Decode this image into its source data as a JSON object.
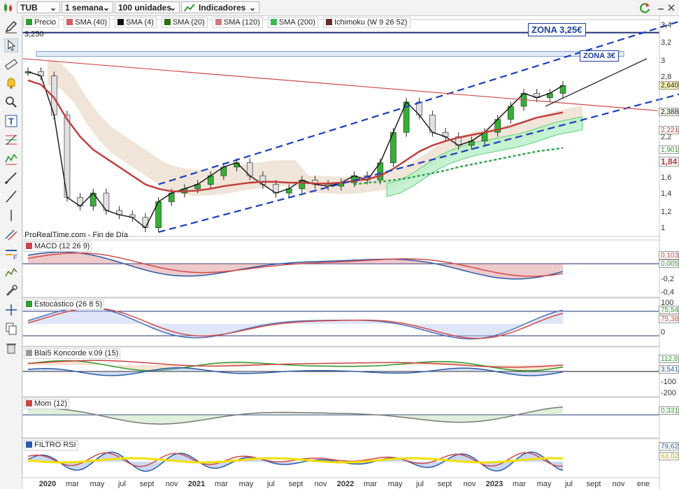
{
  "toolbar": {
    "ticker": "TUB",
    "period": "1 semana",
    "units": "100 unidades",
    "indicators": "Indicadores"
  },
  "price_legend": {
    "items": [
      {
        "label": "Precio",
        "color": "#2e9b2e"
      },
      {
        "label": "SMA (40)",
        "color": "#d95f5f"
      },
      {
        "label": "SMA (4)",
        "color": "#111111"
      },
      {
        "label": "SMA (20)",
        "color": "#2f6f12"
      },
      {
        "label": "SMA (120)",
        "color": "#cf7b7b"
      },
      {
        "label": "SMA (200)",
        "color": "#3dbb55"
      },
      {
        "label": "Ichimoku (W 9 26 52)",
        "color": "#6b2a2a"
      }
    ],
    "level_label": "3,250",
    "watermark": "ProRealTime.com - Fin de Día"
  },
  "annotations": {
    "zona_325": "ZONA 3,25€",
    "zona_3": "ZONA 3€"
  },
  "price_axis": {
    "ticks": [
      "3,4",
      "3,2",
      "3",
      "2,8",
      "2,6",
      "2,4",
      "2,2",
      "2",
      "1,8",
      "1,6",
      "1,4",
      "1,2",
      "1"
    ],
    "badges": [
      {
        "text": "2,640",
        "bg": "#f6f0b0"
      },
      {
        "text": "2,388",
        "bg": "#eef7e8"
      },
      {
        "text": "2,221",
        "bg": "#ffffff"
      },
      {
        "text": "1,901",
        "bg": "#ffffff"
      },
      {
        "text": "1,84",
        "bg": "#ffffff"
      }
    ]
  },
  "panes": {
    "macd": {
      "title": "MACD (12 26 9)",
      "ticks": [
        "-0,2",
        "-0,4"
      ],
      "badges": [
        "0,103",
        "0,005"
      ]
    },
    "stoch": {
      "title": "Estocástico (26 8 5)",
      "ticks": [
        "100",
        "50",
        "0"
      ],
      "badges": [
        "75,54",
        "75,38"
      ]
    },
    "konc": {
      "title": "Blai5 Koncorde v.09 (15)",
      "ticks": [
        "100",
        "0",
        "-100",
        "-200"
      ],
      "badges": [
        "112,8",
        "3,541"
      ]
    },
    "mom": {
      "title": "Mom (12)",
      "ticks": [
        "0"
      ],
      "badges": [
        "0,331"
      ]
    },
    "rsi": {
      "title": "FILTRO RSI",
      "ticks": [],
      "badges": [
        "79,62",
        "63,02"
      ]
    }
  },
  "x_axis": {
    "labels": [
      {
        "text": "2020",
        "bold": true
      },
      {
        "text": "mar",
        "bold": false
      },
      {
        "text": "may",
        "bold": false
      },
      {
        "text": "jul",
        "bold": false
      },
      {
        "text": "sept",
        "bold": false
      },
      {
        "text": "nov",
        "bold": false
      },
      {
        "text": "2021",
        "bold": true
      },
      {
        "text": "mar",
        "bold": false
      },
      {
        "text": "may",
        "bold": false
      },
      {
        "text": "jul",
        "bold": false
      },
      {
        "text": "sept",
        "bold": false
      },
      {
        "text": "nov",
        "bold": false
      },
      {
        "text": "2022",
        "bold": true
      },
      {
        "text": "mar",
        "bold": false
      },
      {
        "text": "may",
        "bold": false
      },
      {
        "text": "jul",
        "bold": false
      },
      {
        "text": "sept",
        "bold": false
      },
      {
        "text": "nov",
        "bold": false
      },
      {
        "text": "2023",
        "bold": true
      },
      {
        "text": "mar",
        "bold": false
      },
      {
        "text": "may",
        "bold": false
      },
      {
        "text": "jul",
        "bold": false
      },
      {
        "text": "sept",
        "bold": false
      },
      {
        "text": "nov",
        "bold": false
      },
      {
        "text": "ene",
        "bold": false
      }
    ]
  },
  "chart_data": {
    "type": "line",
    "title": "TUB",
    "xlabel": "",
    "ylabel": "",
    "x": [
      "2020-01",
      "2020-02",
      "2020-03",
      "2020-04",
      "2020-05",
      "2020-06",
      "2020-07",
      "2020-08",
      "2020-09",
      "2020-10",
      "2020-11",
      "2020-12",
      "2021-01",
      "2021-02",
      "2021-03",
      "2021-04",
      "2021-05",
      "2021-06",
      "2021-07",
      "2021-08",
      "2021-09",
      "2021-10",
      "2021-11",
      "2021-12",
      "2022-01",
      "2022-02",
      "2022-03",
      "2022-04",
      "2022-05",
      "2022-06",
      "2022-07",
      "2022-08",
      "2022-09",
      "2022-10",
      "2022-11",
      "2022-12",
      "2023-01",
      "2023-02",
      "2023-03",
      "2023-04",
      "2023-05",
      "2023-06"
    ],
    "ylim": [
      0.9,
      3.4
    ],
    "series": [
      {
        "name": "Precio",
        "values": [
          2.8,
          2.75,
          2.3,
          1.35,
          1.25,
          1.4,
          1.2,
          1.15,
          1.12,
          1.0,
          1.3,
          1.4,
          1.45,
          1.5,
          1.6,
          1.7,
          1.75,
          1.6,
          1.5,
          1.4,
          1.45,
          1.55,
          1.5,
          1.48,
          1.52,
          1.6,
          1.55,
          1.75,
          2.1,
          2.45,
          2.3,
          2.1,
          2.05,
          1.95,
          2.0,
          2.1,
          2.25,
          2.4,
          2.55,
          2.5,
          2.55,
          2.64
        ]
      },
      {
        "name": "SMA (40)",
        "values": [
          2.7,
          2.65,
          2.5,
          2.25,
          2.05,
          1.9,
          1.8,
          1.7,
          1.6,
          1.5,
          1.45,
          1.42,
          1.42,
          1.43,
          1.45,
          1.48,
          1.5,
          1.52,
          1.53,
          1.53,
          1.52,
          1.52,
          1.51,
          1.51,
          1.52,
          1.54,
          1.56,
          1.6,
          1.68,
          1.78,
          1.88,
          1.95,
          2.0,
          2.04,
          2.07,
          2.1,
          2.13,
          2.17,
          2.22,
          2.27,
          2.3,
          2.33
        ]
      },
      {
        "name": "SMA (200)",
        "values": [
          null,
          null,
          null,
          null,
          null,
          null,
          null,
          null,
          null,
          null,
          null,
          null,
          null,
          null,
          null,
          null,
          null,
          null,
          null,
          null,
          null,
          null,
          null,
          null,
          null,
          1.5,
          1.52,
          1.53,
          1.55,
          1.57,
          1.6,
          1.63,
          1.66,
          1.7,
          1.73,
          1.76,
          1.79,
          1.82,
          1.85,
          1.88,
          1.9,
          1.92
        ]
      }
    ],
    "trendlines": [
      {
        "name": "canal superior",
        "from": [
          "2020-11",
          1.5
        ],
        "to": [
          "2023-10",
          3.2
        ]
      },
      {
        "name": "canal inferior",
        "from": [
          "2020-11",
          0.95
        ],
        "to": [
          "2023-10",
          2.35
        ]
      }
    ],
    "levels": [
      3.25,
      3.0
    ]
  }
}
